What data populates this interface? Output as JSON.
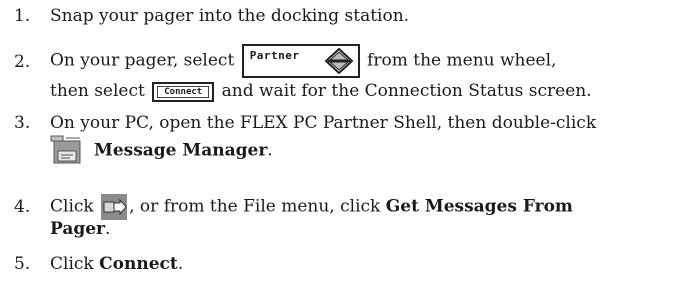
{
  "steps": [
    {
      "number": "1.",
      "text": "Snap your pager into the docking station."
    },
    {
      "number": "2.",
      "line1_before": "On your pager, select",
      "line1_after": "from the menu wheel,",
      "menu_label": "Partner",
      "line2_before": "then select",
      "button_label": "Connect",
      "line2_after": "and wait for the Connection Status screen."
    },
    {
      "number": "3.",
      "line1": "On your PC, open the FLEX PC Partner Shell, then double-click",
      "bold": "Message Manager",
      "after": "."
    },
    {
      "number": "4.",
      "before": "Click",
      "middle": ", or from the File menu, click",
      "bold1": "Get Messages From",
      "bold2": "Pager",
      "after": "."
    },
    {
      "number": "5.",
      "before": "Click",
      "bold": "Connect",
      "after": "."
    }
  ],
  "icons": {
    "menu_arrows": "up-down-arrow-icon",
    "message_manager": "message-manager-icon",
    "get_messages": "get-messages-icon"
  },
  "colors": {
    "text": "#1a1a1a",
    "icon_gray": "#7a7a7a"
  }
}
